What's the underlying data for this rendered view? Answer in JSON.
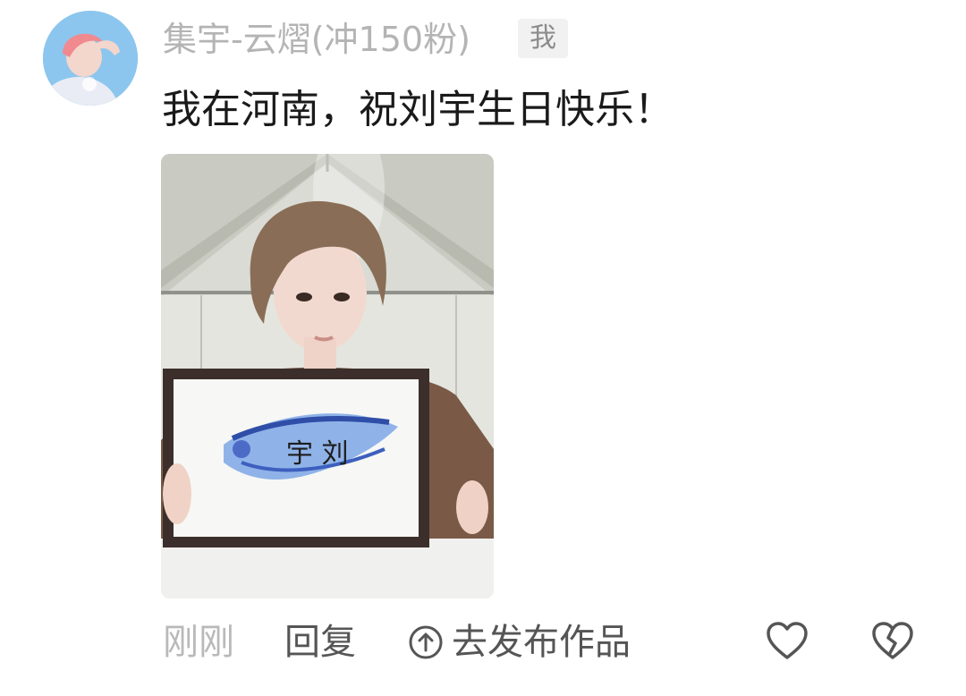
{
  "comment": {
    "username": "集宇-云熠(冲150粉)",
    "self_badge": "我",
    "text": "我在河南，祝刘宇生日快乐！",
    "avatar_icon": "user-avatar-photo",
    "photo_icon": "attached-photo"
  },
  "actions": {
    "time": "刚刚",
    "reply_label": "回复",
    "publish_label": "去发布作品",
    "publish_icon": "circle-arrow-up-icon",
    "like_icon": "heart-outline-icon",
    "dislike_icon": "broken-heart-icon"
  },
  "colors": {
    "username": "#b4b4b4",
    "text": "#1a1a1a",
    "action_text": "#555555",
    "time_text": "#b9b9b9",
    "icon_stroke": "#555555"
  }
}
